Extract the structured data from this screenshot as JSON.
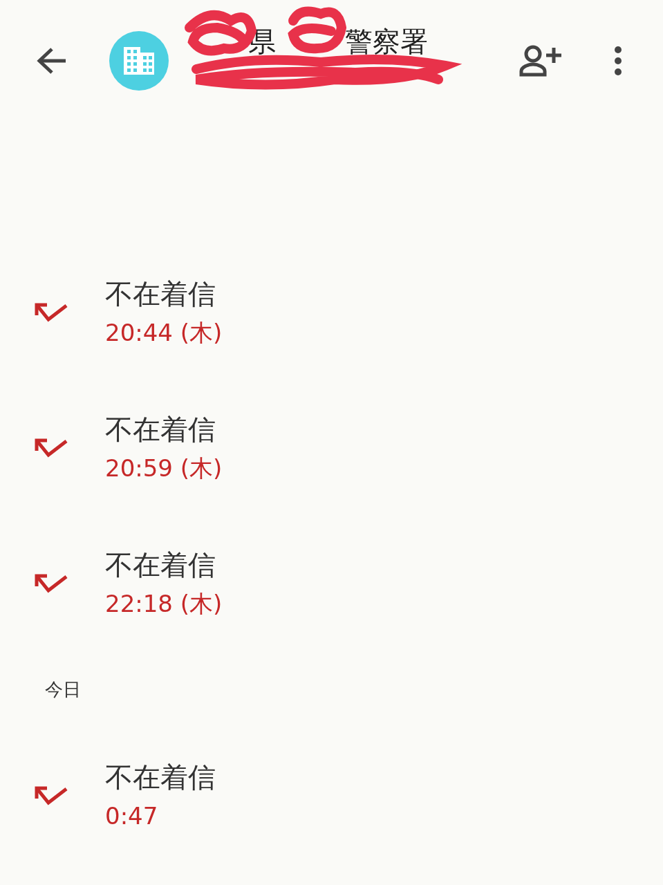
{
  "header": {
    "title_parts": [
      "県",
      "警察署"
    ],
    "redacted": true
  },
  "groups": [
    {
      "calls": [
        {
          "title": "不在着信",
          "time": "20:44 (木)"
        },
        {
          "title": "不在着信",
          "time": "20:59 (木)"
        },
        {
          "title": "不在着信",
          "time": "22:18 (木)"
        }
      ]
    },
    {
      "label": "今日",
      "calls": [
        {
          "title": "不在着信",
          "time": "0:47"
        }
      ]
    }
  ]
}
